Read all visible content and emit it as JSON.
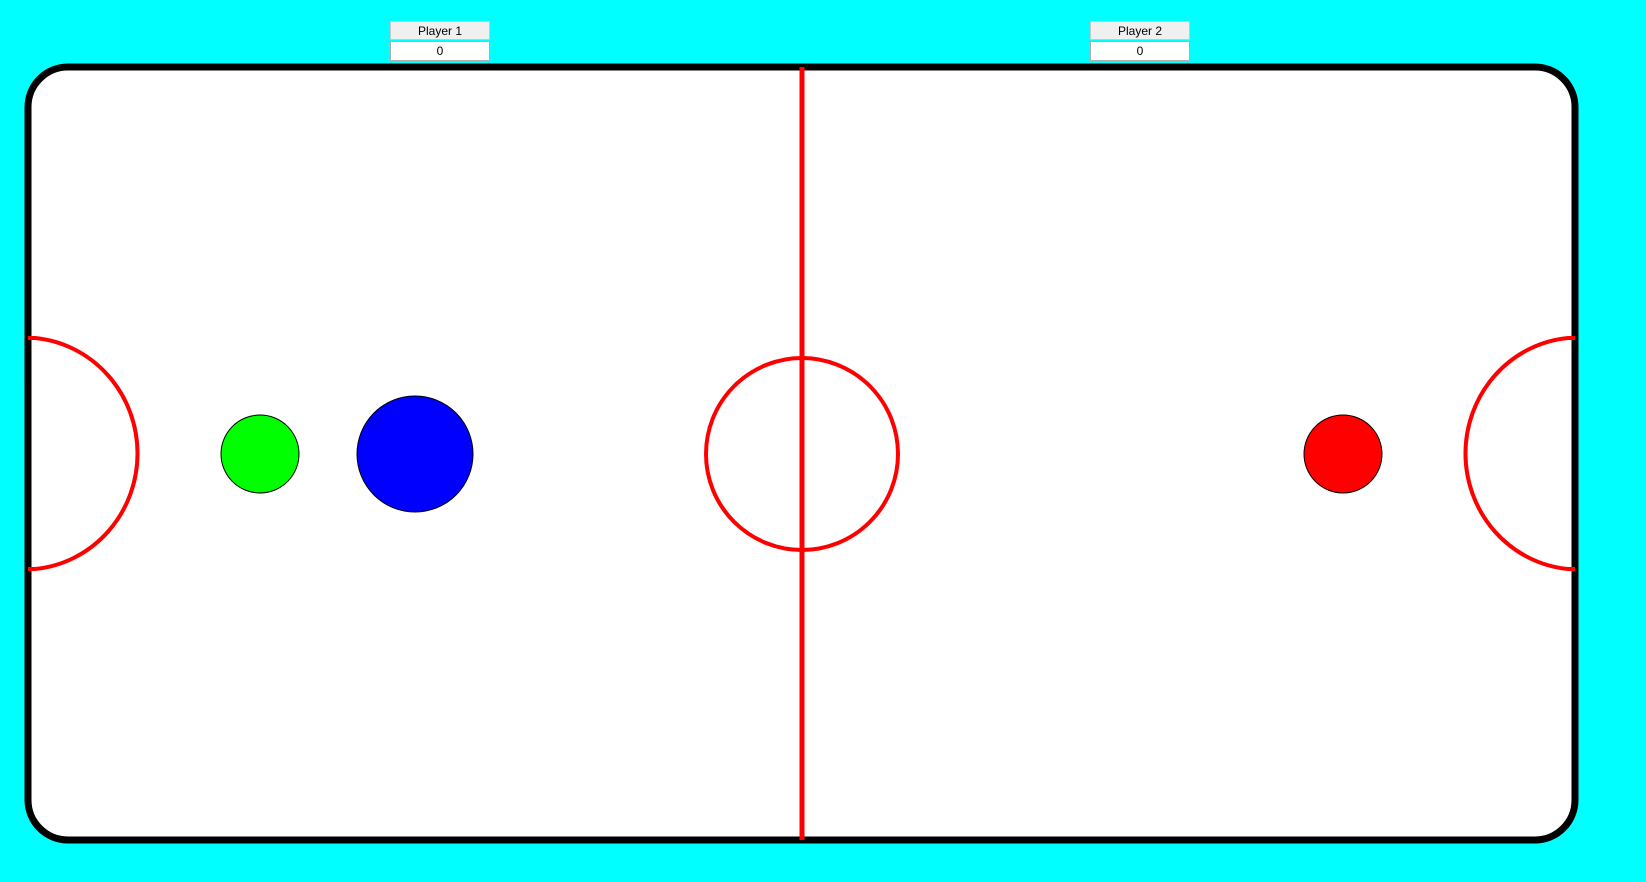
{
  "scoreboard": {
    "player1": {
      "label": "Player 1",
      "score": "0"
    },
    "player2": {
      "label": "Player 2",
      "score": "0"
    }
  },
  "colors": {
    "background": "#00ffff",
    "rink_fill": "#ffffff",
    "rink_border": "#000000",
    "rink_markings": "#ff0000",
    "player1_mallet": "#0000ff",
    "player2_mallet": "#ff0000",
    "puck": "#00ff00"
  }
}
